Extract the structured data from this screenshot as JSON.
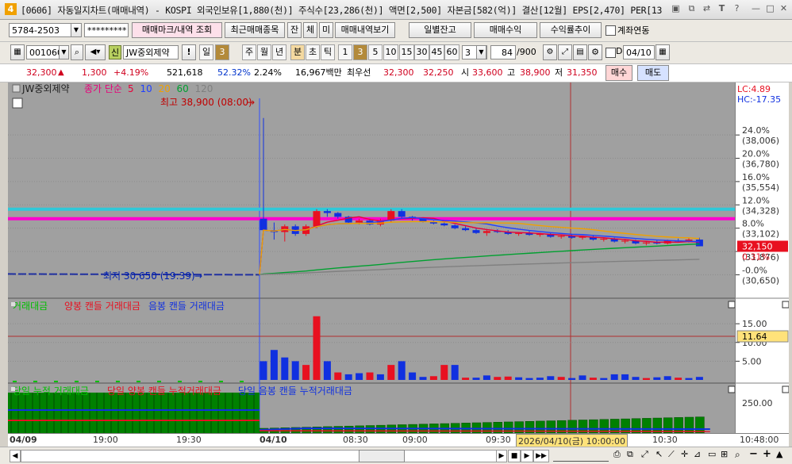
{
  "window": {
    "badge": "4",
    "title": "[0606] 자동일지차트(매매내역) - KOSPI 외국인보유[1,880(천)] 주식수[23,286(천)] 액면[2,500] 자본금[582(억)] 결산[12월] EPS[2,470] PER[13",
    "icons": [
      "restore-icon",
      "copy-icon",
      "swap-icon",
      "font-icon",
      "help-icon",
      "minimize-icon",
      "maximize-icon",
      "close-icon"
    ]
  },
  "toolbar1": {
    "account": "5784-2503",
    "password": "*********",
    "btn_trade_mark": "매매마크/내역 조회",
    "btn_recent": "최근매매종목",
    "btn_jan": "잔",
    "btn_che": "체",
    "btn_mi": "미",
    "btn_history": "매매내역보기",
    "btn_daily": "일별잔고",
    "btn_profit": "매매수익",
    "btn_return": "수익률추이",
    "chk_link": "계좌연동"
  },
  "toolbar2": {
    "code": "001060",
    "credit": "신",
    "stock_name": "JW중외제약",
    "exclaim": "!",
    "period_day": "일",
    "period_n": "3",
    "periods": [
      "주",
      "월",
      "년",
      "분",
      "초",
      "틱"
    ],
    "nums": [
      "1",
      "3",
      "5",
      "10",
      "15",
      "30",
      "45",
      "60"
    ],
    "select_n": "3",
    "count": "84",
    "total": "/900",
    "chk_d": "D",
    "date": "04/10"
  },
  "quote": {
    "price": "32,300",
    "change": "1,300",
    "rate": "+4.19%",
    "volume": "521,618",
    "vol_rate": "52.32%",
    "turnover": "2.24%",
    "amount": "16,967백만",
    "best_label": "최우선",
    "ask": "32,300",
    "bid": "32,250",
    "open_label": "시",
    "open": "33,600",
    "high_label": "고",
    "high": "38,900",
    "low_label": "저",
    "low": "31,350",
    "buy": "매수",
    "sell": "매도"
  },
  "chart_data": {
    "type": "candlestick",
    "legend": {
      "name": "JW중외제약",
      "ma_label": "종가 단순",
      "ma_periods": [
        "5",
        "10",
        "20",
        "60",
        "120"
      ],
      "ma_colors": [
        "#e8003a",
        "#2040ff",
        "#f0a000",
        "#00a030",
        "#808080"
      ]
    },
    "annotations": {
      "high": "최고 38,900 (08:00)",
      "low": "최저 30,650 (19:39)"
    },
    "price_axis": {
      "top_labels": [
        "LC:4.89",
        "HC:-17.35"
      ],
      "ticks": [
        {
          "pct": "24.0%",
          "price": "(38,006)"
        },
        {
          "pct": "20.0%",
          "price": "(36,780)"
        },
        {
          "pct": "16.0%",
          "price": "(35,554)"
        },
        {
          "pct": "12.0%",
          "price": "(34,328)"
        },
        {
          "pct": "8.0%",
          "price": "(33,102)"
        },
        {
          "pct": "4.0%",
          "price": "(31,876)"
        },
        {
          "pct": "-0.0%",
          "price": "(30,650)"
        }
      ],
      "current": "32,150",
      "current_pct": "0.31%",
      "range": [
        30650,
        38900
      ]
    },
    "hlines": [
      {
        "color": "#30c8d8",
        "price": 34100
      },
      {
        "color": "#ff00d0",
        "price": 33600
      }
    ],
    "candles": [
      {
        "o": 33600,
        "h": 38900,
        "l": 32900,
        "c": 33000
      },
      {
        "o": 33000,
        "h": 33400,
        "l": 32500,
        "c": 32900
      },
      {
        "o": 32900,
        "h": 33300,
        "l": 32400,
        "c": 33200
      },
      {
        "o": 33200,
        "h": 33300,
        "l": 32700,
        "c": 32800
      },
      {
        "o": 32800,
        "h": 33300,
        "l": 32700,
        "c": 33200
      },
      {
        "o": 33200,
        "h": 34100,
        "l": 33100,
        "c": 34000
      },
      {
        "o": 34000,
        "h": 34100,
        "l": 33700,
        "c": 33900
      },
      {
        "o": 33900,
        "h": 33950,
        "l": 33600,
        "c": 33700
      },
      {
        "o": 33700,
        "h": 33750,
        "l": 33350,
        "c": 33400
      },
      {
        "o": 33400,
        "h": 33600,
        "l": 33300,
        "c": 33500
      },
      {
        "o": 33500,
        "h": 33600,
        "l": 33250,
        "c": 33300
      },
      {
        "o": 33300,
        "h": 33600,
        "l": 33200,
        "c": 33500
      },
      {
        "o": 33500,
        "h": 34100,
        "l": 33400,
        "c": 34000
      },
      {
        "o": 34000,
        "h": 34100,
        "l": 33600,
        "c": 33700
      },
      {
        "o": 33700,
        "h": 33750,
        "l": 33500,
        "c": 33600
      },
      {
        "o": 33600,
        "h": 33650,
        "l": 33400,
        "c": 33450
      },
      {
        "o": 33450,
        "h": 33500,
        "l": 33300,
        "c": 33350
      },
      {
        "o": 33350,
        "h": 33450,
        "l": 33200,
        "c": 33250
      },
      {
        "o": 33250,
        "h": 33300,
        "l": 33050,
        "c": 33100
      },
      {
        "o": 33100,
        "h": 33200,
        "l": 32950,
        "c": 33000
      },
      {
        "o": 33000,
        "h": 33100,
        "l": 32800,
        "c": 32850
      },
      {
        "o": 32850,
        "h": 33000,
        "l": 32700,
        "c": 32950
      },
      {
        "o": 32950,
        "h": 33050,
        "l": 32850,
        "c": 32900
      },
      {
        "o": 32900,
        "h": 33000,
        "l": 32750,
        "c": 32800
      },
      {
        "o": 32800,
        "h": 32900,
        "l": 32700,
        "c": 32850
      },
      {
        "o": 32850,
        "h": 32950,
        "l": 32700,
        "c": 32750
      },
      {
        "o": 32750,
        "h": 32850,
        "l": 32650,
        "c": 32800
      },
      {
        "o": 32800,
        "h": 32850,
        "l": 32600,
        "c": 32650
      },
      {
        "o": 32650,
        "h": 32750,
        "l": 32550,
        "c": 32700
      },
      {
        "o": 32700,
        "h": 32800,
        "l": 32550,
        "c": 32600
      },
      {
        "o": 32600,
        "h": 32700,
        "l": 32500,
        "c": 32650
      },
      {
        "o": 32650,
        "h": 32700,
        "l": 32450,
        "c": 32500
      },
      {
        "o": 32500,
        "h": 32600,
        "l": 32400,
        "c": 32550
      },
      {
        "o": 32550,
        "h": 32600,
        "l": 32350,
        "c": 32400
      },
      {
        "o": 32400,
        "h": 32500,
        "l": 32300,
        "c": 32450
      },
      {
        "o": 32450,
        "h": 32500,
        "l": 32250,
        "c": 32300
      },
      {
        "o": 32300,
        "h": 32400,
        "l": 32200,
        "c": 32350
      },
      {
        "o": 32350,
        "h": 32450,
        "l": 32250,
        "c": 32300
      },
      {
        "o": 32300,
        "h": 32500,
        "l": 32250,
        "c": 32450
      },
      {
        "o": 32450,
        "h": 32550,
        "l": 32350,
        "c": 32400
      },
      {
        "o": 32400,
        "h": 32600,
        "l": 32350,
        "c": 32500
      },
      {
        "o": 32500,
        "h": 32600,
        "l": 32150,
        "c": 32150
      }
    ],
    "volume_panel": {
      "legend": [
        "거래대금",
        "양봉 캔들 거래대금",
        "음봉 캔들 거래대금"
      ],
      "ticks": [
        "15.00",
        "10.00",
        "5.00"
      ],
      "current": "11.64",
      "max": 18,
      "bars": [
        {
          "v": 5,
          "up": false
        },
        {
          "v": 8,
          "up": false
        },
        {
          "v": 6,
          "up": false
        },
        {
          "v": 5,
          "up": false
        },
        {
          "v": 4,
          "up": true
        },
        {
          "v": 17,
          "up": true
        },
        {
          "v": 5,
          "up": false
        },
        {
          "v": 2,
          "up": true
        },
        {
          "v": 1.5,
          "up": false
        },
        {
          "v": 1.8,
          "up": false
        },
        {
          "v": 2,
          "up": true
        },
        {
          "v": 1.5,
          "up": false
        },
        {
          "v": 4,
          "up": true
        },
        {
          "v": 5,
          "up": false
        },
        {
          "v": 2,
          "up": false
        },
        {
          "v": 0.8,
          "up": false
        },
        {
          "v": 1,
          "up": true
        },
        {
          "v": 4,
          "up": true
        },
        {
          "v": 4,
          "up": false
        },
        {
          "v": 0.6,
          "up": true
        },
        {
          "v": 0.6,
          "up": false
        },
        {
          "v": 1.2,
          "up": false
        },
        {
          "v": 0.8,
          "up": true
        },
        {
          "v": 0.9,
          "up": true
        },
        {
          "v": 0.7,
          "up": false
        },
        {
          "v": 0.5,
          "up": false
        },
        {
          "v": 0.6,
          "up": false
        },
        {
          "v": 1,
          "up": false
        },
        {
          "v": 0.8,
          "up": true
        },
        {
          "v": 0.5,
          "up": false
        },
        {
          "v": 1.2,
          "up": false
        },
        {
          "v": 0.6,
          "up": true
        },
        {
          "v": 0.5,
          "up": false
        },
        {
          "v": 1.5,
          "up": false
        },
        {
          "v": 1.5,
          "up": false
        },
        {
          "v": 0.8,
          "up": false
        },
        {
          "v": 0.5,
          "up": true
        },
        {
          "v": 0.7,
          "up": false
        },
        {
          "v": 1,
          "up": false
        },
        {
          "v": 0.6,
          "up": true
        },
        {
          "v": 0.5,
          "up": false
        },
        {
          "v": 0.8,
          "up": false
        }
      ]
    },
    "cum_panel": {
      "legend": [
        "당일 누적 거래대금",
        "당일 양봉 캔들 누적거래대금",
        "당일 음봉 캔들 누적거래대금"
      ],
      "ticks": [
        "250.00"
      ]
    },
    "time_axis": [
      "04/09",
      "19:00",
      "19:30",
      "04/10",
      "08:30",
      "09:00",
      "09:30",
      "10:30",
      "10:48:00"
    ],
    "cursor_label": "2026/04/10(금) 10:00:00"
  }
}
